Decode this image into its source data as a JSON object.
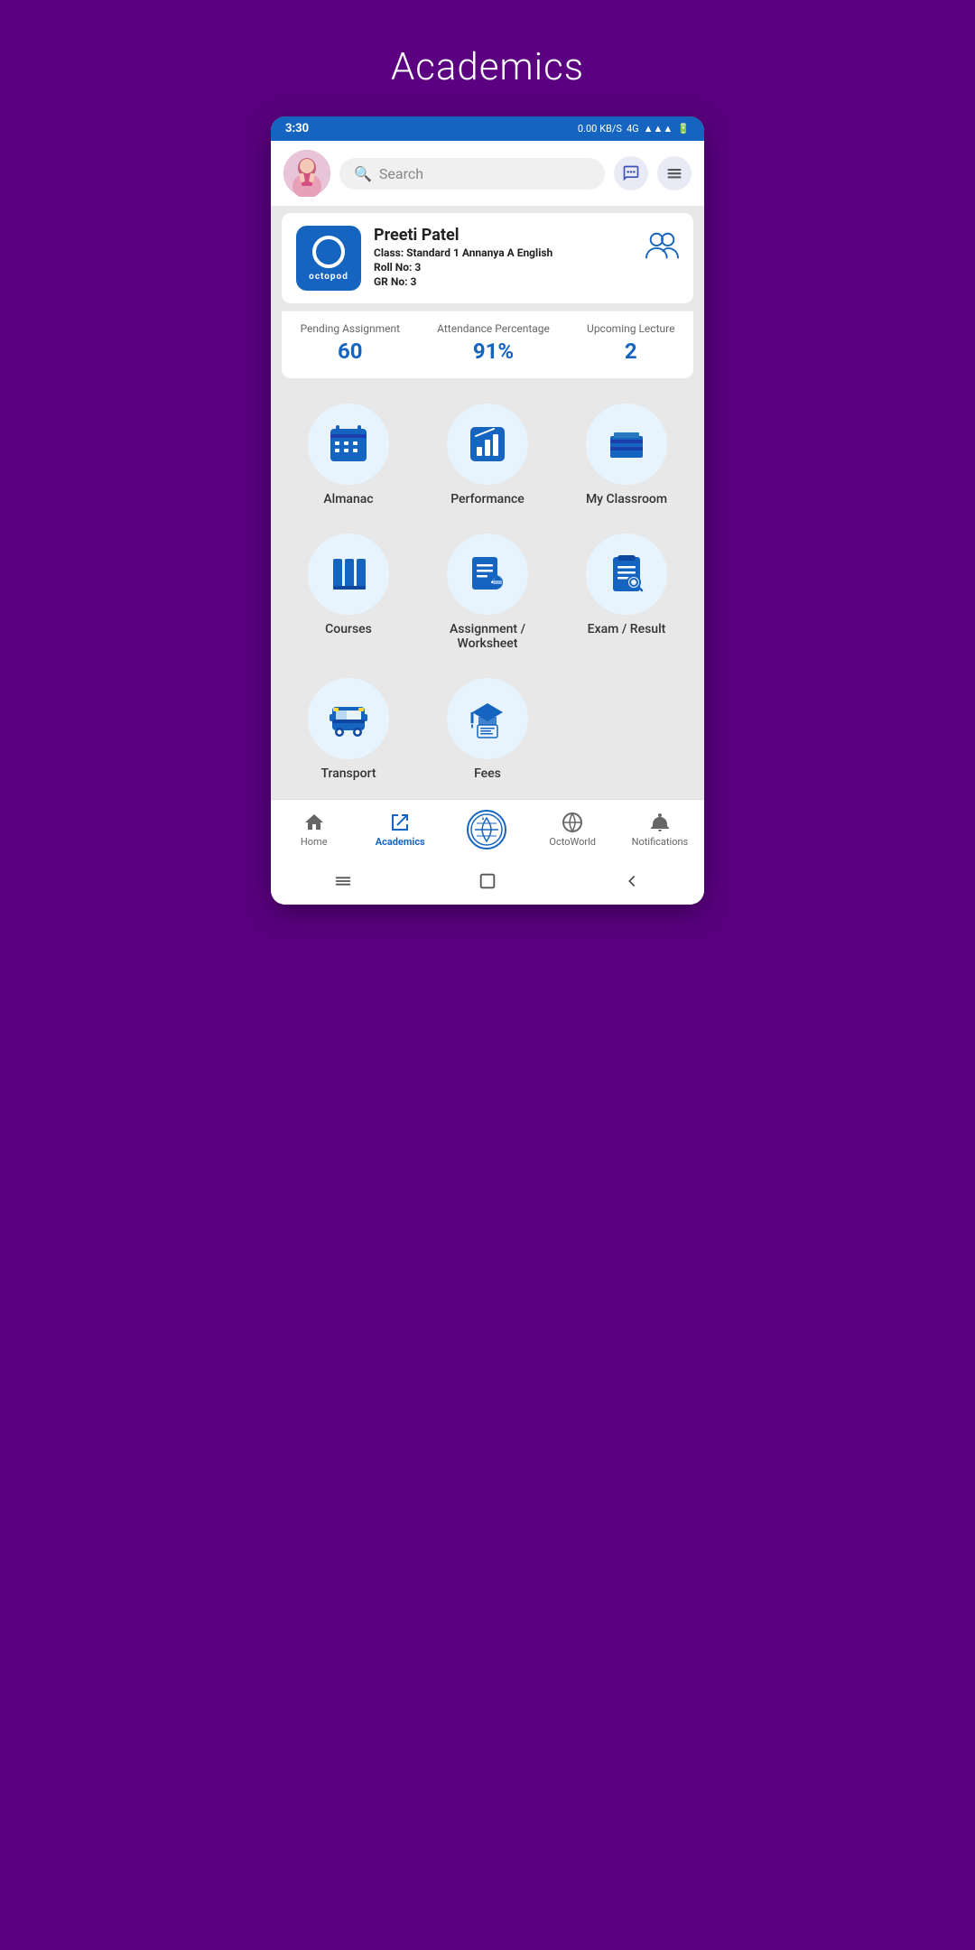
{
  "page": {
    "title": "Academics",
    "background_color": "#5a0080"
  },
  "status_bar": {
    "time": "3:30",
    "network_speed": "0.00 KB/S",
    "network_type": "4G",
    "battery": "6"
  },
  "search": {
    "placeholder": "Search"
  },
  "profile": {
    "name": "Preeti Patel",
    "class_label": "Class:",
    "class_value": "Standard 1 Annanya A English",
    "roll_label": "Roll No:",
    "roll_value": "3",
    "gr_label": "GR No:",
    "gr_value": "3",
    "logo_text": "octopod"
  },
  "stats": [
    {
      "label": "Pending Assignment",
      "value": "60"
    },
    {
      "label": "Attendance Percentage",
      "value": "91%"
    },
    {
      "label": "Upcoming Lecture",
      "value": "2"
    }
  ],
  "menu_items": [
    {
      "id": "almanac",
      "label": "Almanac"
    },
    {
      "id": "performance",
      "label": "Performance"
    },
    {
      "id": "my-classroom",
      "label": "My Classroom"
    },
    {
      "id": "courses",
      "label": "Courses"
    },
    {
      "id": "assignment-worksheet",
      "label": "Assignment / Worksheet"
    },
    {
      "id": "exam-result",
      "label": "Exam / Result"
    },
    {
      "id": "transport",
      "label": "Transport"
    },
    {
      "id": "fees",
      "label": "Fees"
    }
  ],
  "bottom_nav": [
    {
      "id": "home",
      "label": "Home",
      "active": false
    },
    {
      "id": "academics",
      "label": "Academics",
      "active": true
    },
    {
      "id": "octoworld-plus",
      "label": "",
      "active": false,
      "is_center": true
    },
    {
      "id": "octoworld",
      "label": "OctoWorld",
      "active": false
    },
    {
      "id": "notifications",
      "label": "Notifications",
      "active": false
    }
  ]
}
